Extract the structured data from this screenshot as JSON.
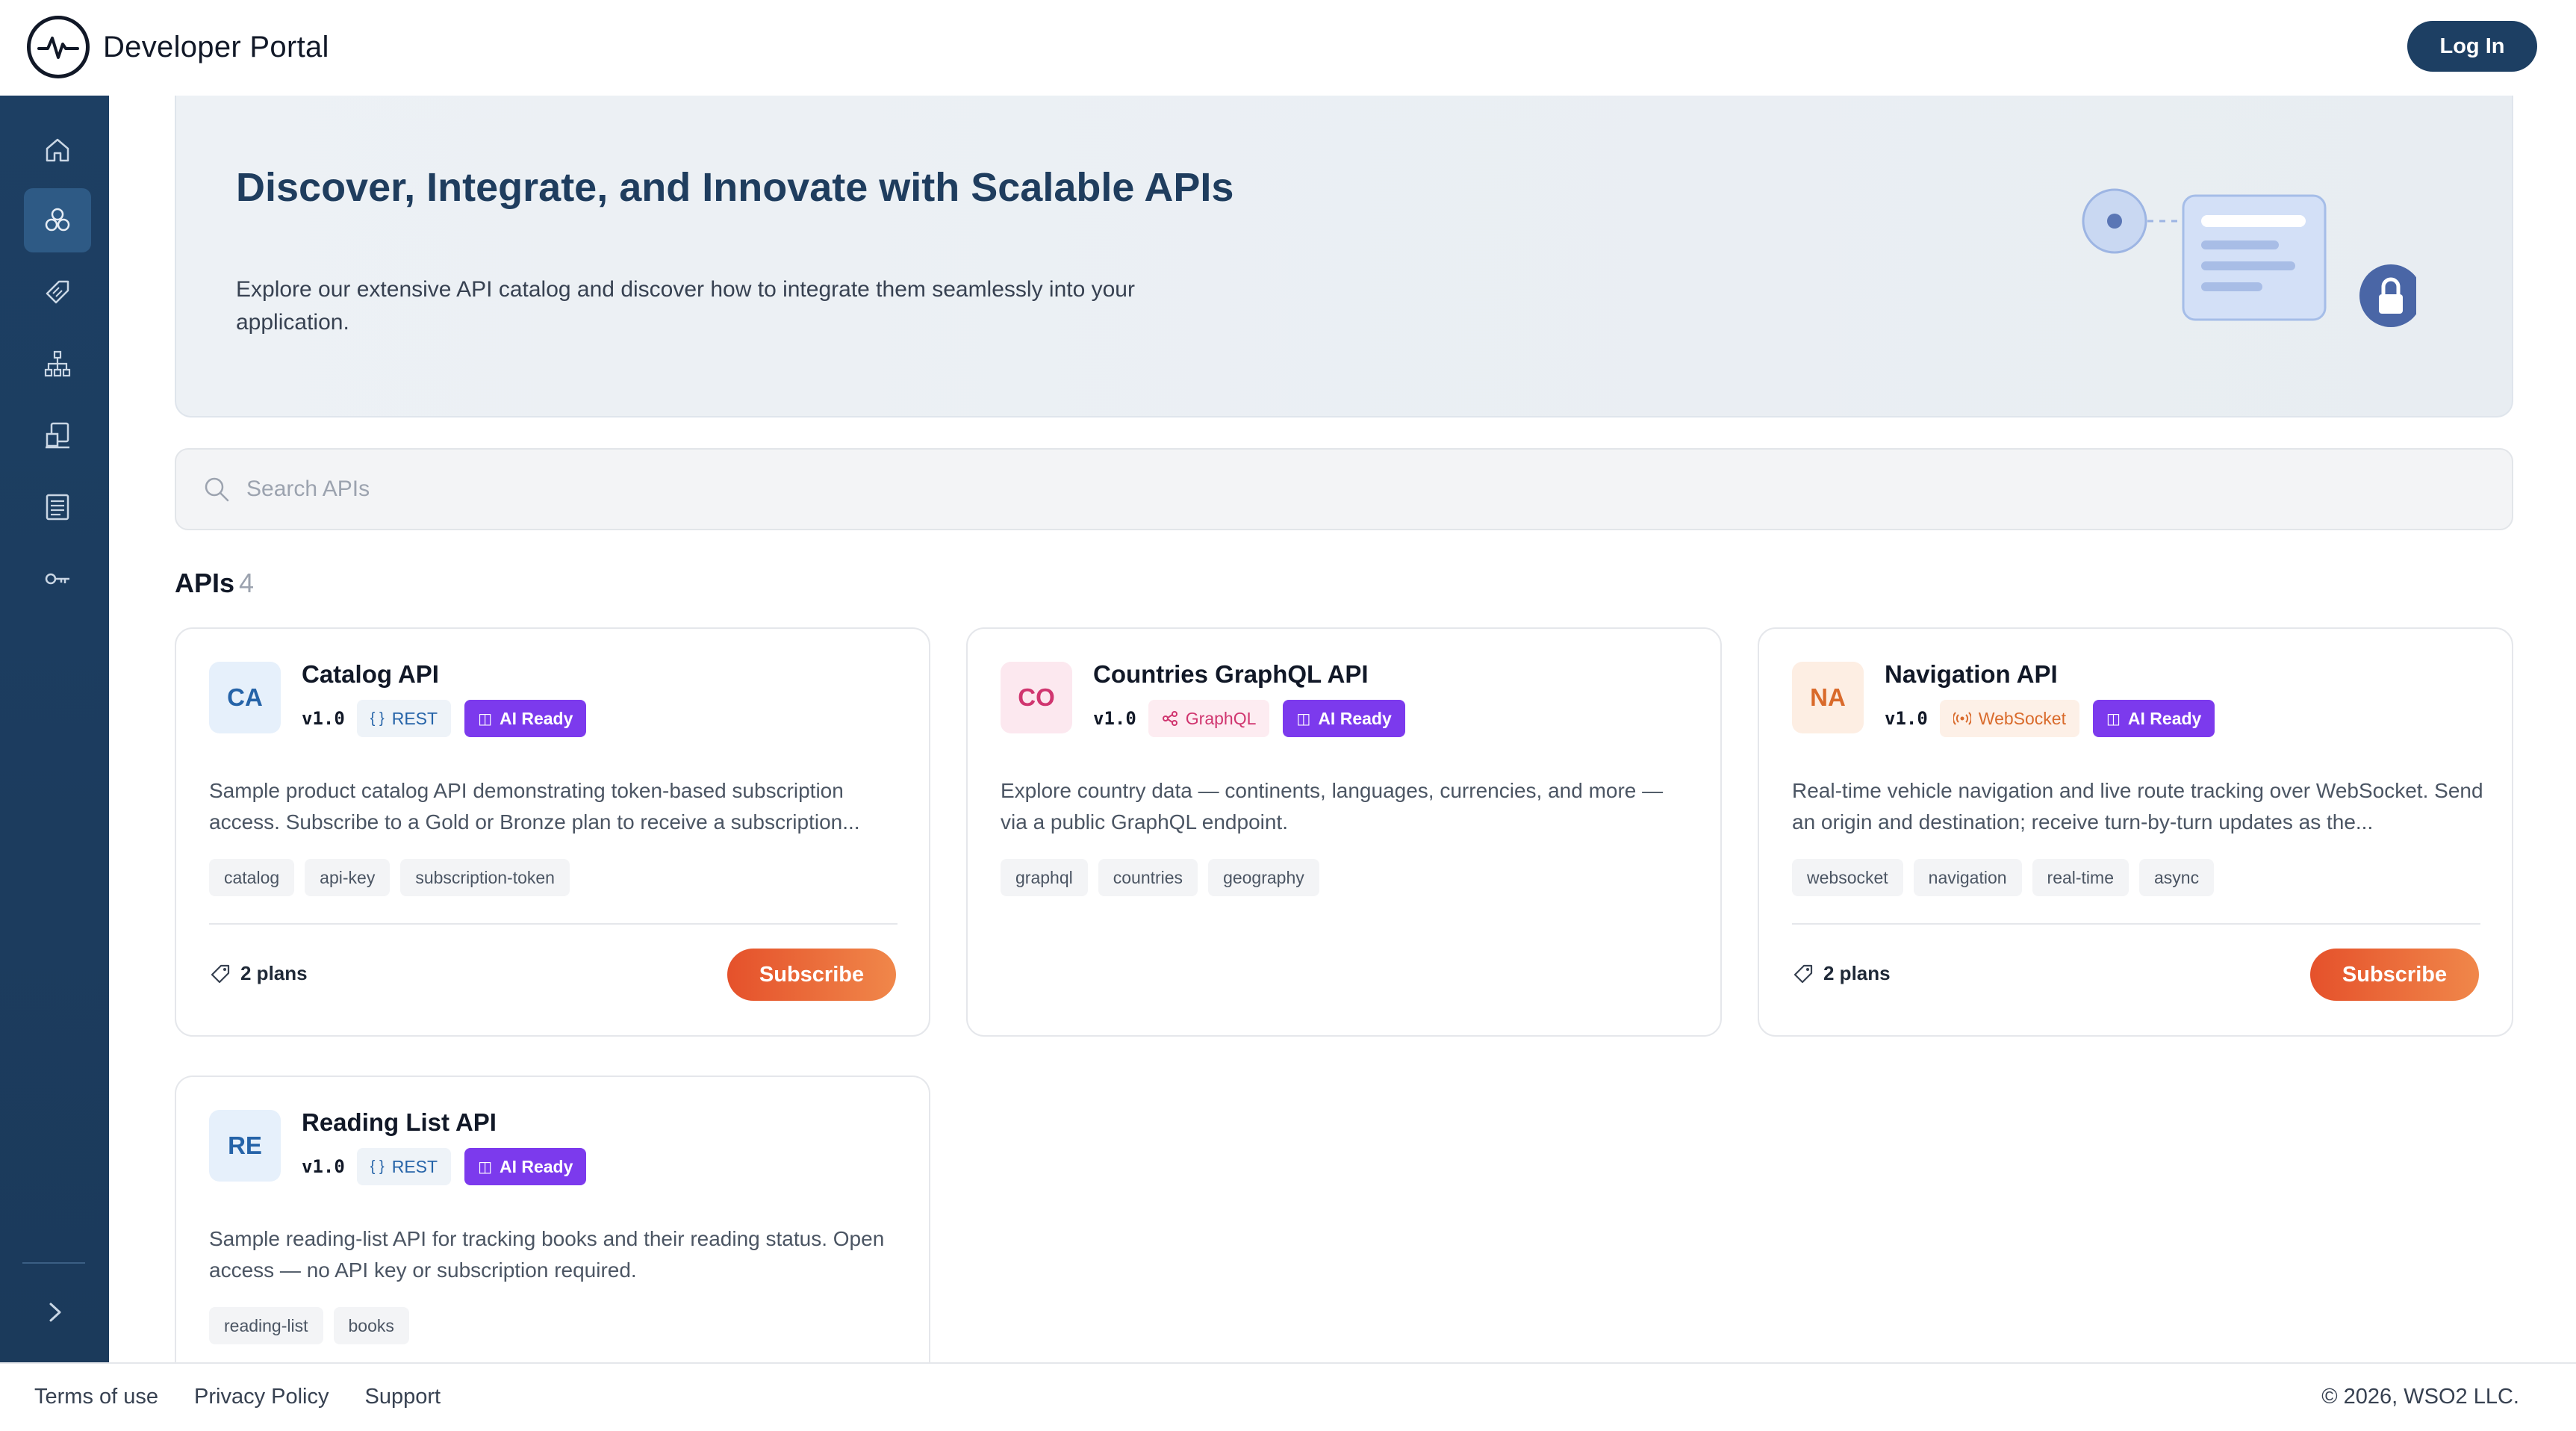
{
  "header": {
    "title": "Developer Portal",
    "login_label": "Log In"
  },
  "sidebar": {
    "items": [
      {
        "name": "home-icon",
        "active": false
      },
      {
        "name": "apis-icon",
        "active": true
      },
      {
        "name": "tag-icon",
        "active": false
      },
      {
        "name": "hierarchy-icon",
        "active": false
      },
      {
        "name": "applications-icon",
        "active": false
      },
      {
        "name": "documents-icon",
        "active": false
      },
      {
        "name": "key-icon",
        "active": false
      }
    ],
    "expand_icon": "chevron-right-icon"
  },
  "hero": {
    "title": "Discover, Integrate, and Innovate with Scalable APIs",
    "subtitle": "Explore our extensive API catalog and discover how to integrate them seamlessly into your application."
  },
  "search": {
    "placeholder": "Search APIs"
  },
  "apis_section": {
    "title": "APIs",
    "count": "4"
  },
  "cards": [
    {
      "initials": "CA",
      "name": "Catalog API",
      "version": "v1.0",
      "type_label": "REST",
      "type_icon": "{ }",
      "ai_label": "AI Ready",
      "description": "Sample product catalog API demonstrating token-based subscription access. Subscribe to a Gold or Bronze plan to receive a subscription...",
      "tags": [
        "catalog",
        "api-key",
        "subscription-token"
      ],
      "plans_label": "2 plans",
      "subscribe_label": "Subscribe"
    },
    {
      "initials": "CO",
      "name": "Countries GraphQL API",
      "version": "v1.0",
      "type_label": "GraphQL",
      "type_icon": "share",
      "ai_label": "AI Ready",
      "description": "Explore country data — continents, languages, currencies, and more — via a public GraphQL endpoint.",
      "tags": [
        "graphql",
        "countries",
        "geography"
      ]
    },
    {
      "initials": "NA",
      "name": "Navigation API",
      "version": "v1.0",
      "type_label": "WebSocket",
      "type_icon": "broadcast",
      "ai_label": "AI Ready",
      "description": "Real-time vehicle navigation and live route tracking over WebSocket. Send an origin and destination; receive turn-by-turn updates as the...",
      "tags": [
        "websocket",
        "navigation",
        "real-time",
        "async"
      ],
      "plans_label": "2 plans",
      "subscribe_label": "Subscribe"
    },
    {
      "initials": "RE",
      "name": "Reading List API",
      "version": "v1.0",
      "type_label": "REST",
      "type_icon": "{ }",
      "ai_label": "AI Ready",
      "description": "Sample reading-list API for tracking books and their reading status. Open access — no API key or subscription required.",
      "tags": [
        "reading-list",
        "books"
      ]
    }
  ],
  "footer": {
    "links": [
      "Terms of use",
      "Privacy Policy",
      "Support"
    ],
    "copyright": "© 2026, WSO2 LLC."
  },
  "colors": {
    "sidebar": "#1d3f63",
    "accent": "#e5512b",
    "ai_badge": "#7c3aed",
    "hero_title": "#1f3d5e"
  }
}
